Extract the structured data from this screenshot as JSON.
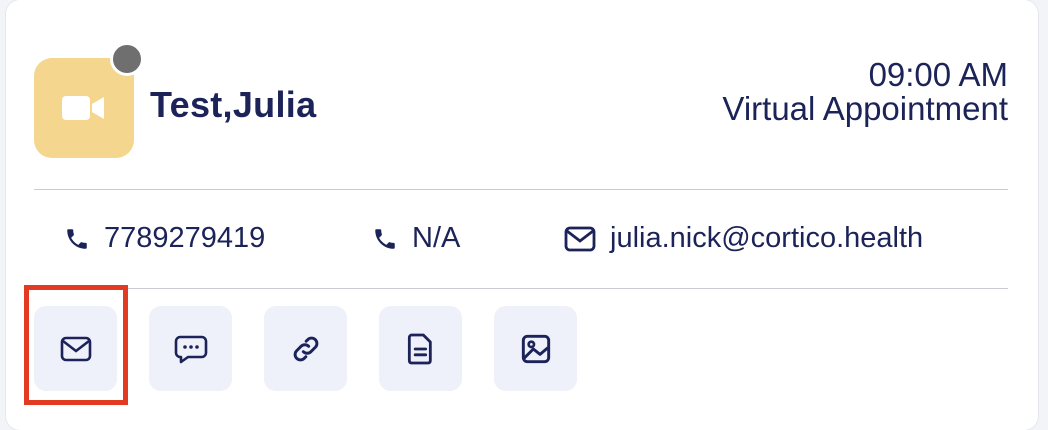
{
  "appointment": {
    "patient_name": "Test,Julia",
    "time": "09:00 AM",
    "type": "Virtual Appointment",
    "avatar_icon": "video-camera-icon",
    "avatar_color": "#f5d68f",
    "status_color": "#6f6f6f"
  },
  "contacts": {
    "phone_primary": "7789279419",
    "phone_secondary": "N/A",
    "email": "julia.nick@cortico.health"
  },
  "actions": [
    {
      "icon": "mail-icon"
    },
    {
      "icon": "message-icon"
    },
    {
      "icon": "link-icon"
    },
    {
      "icon": "document-icon"
    },
    {
      "icon": "image-icon"
    }
  ],
  "accent_highlight": "#e23b22"
}
